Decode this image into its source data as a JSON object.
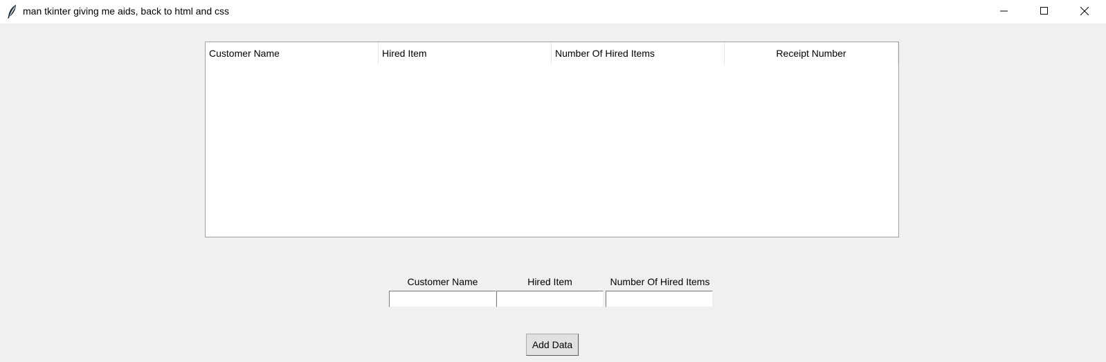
{
  "window": {
    "title": "man tkinter giving me aids, back to html and css",
    "icon": "feather-icon",
    "controls": [
      "minimize-icon",
      "maximize-icon",
      "close-icon"
    ]
  },
  "table": {
    "columns": [
      "Customer Name",
      "Hired Item",
      "Number Of Hired Items",
      "Receipt Number"
    ],
    "rows": []
  },
  "form": {
    "customer_name_label": "Customer Name",
    "hired_item_label": "Hired Item",
    "number_label": "Number Of Hired Items",
    "customer_name_value": "",
    "hired_item_value": "",
    "number_value": "",
    "add_button_label": "Add Data"
  },
  "colors": {
    "window_bg": "#f0f0f0",
    "titlebar_bg": "#ffffff",
    "table_bg": "#ffffff",
    "button_bg": "#e1e1e1"
  }
}
